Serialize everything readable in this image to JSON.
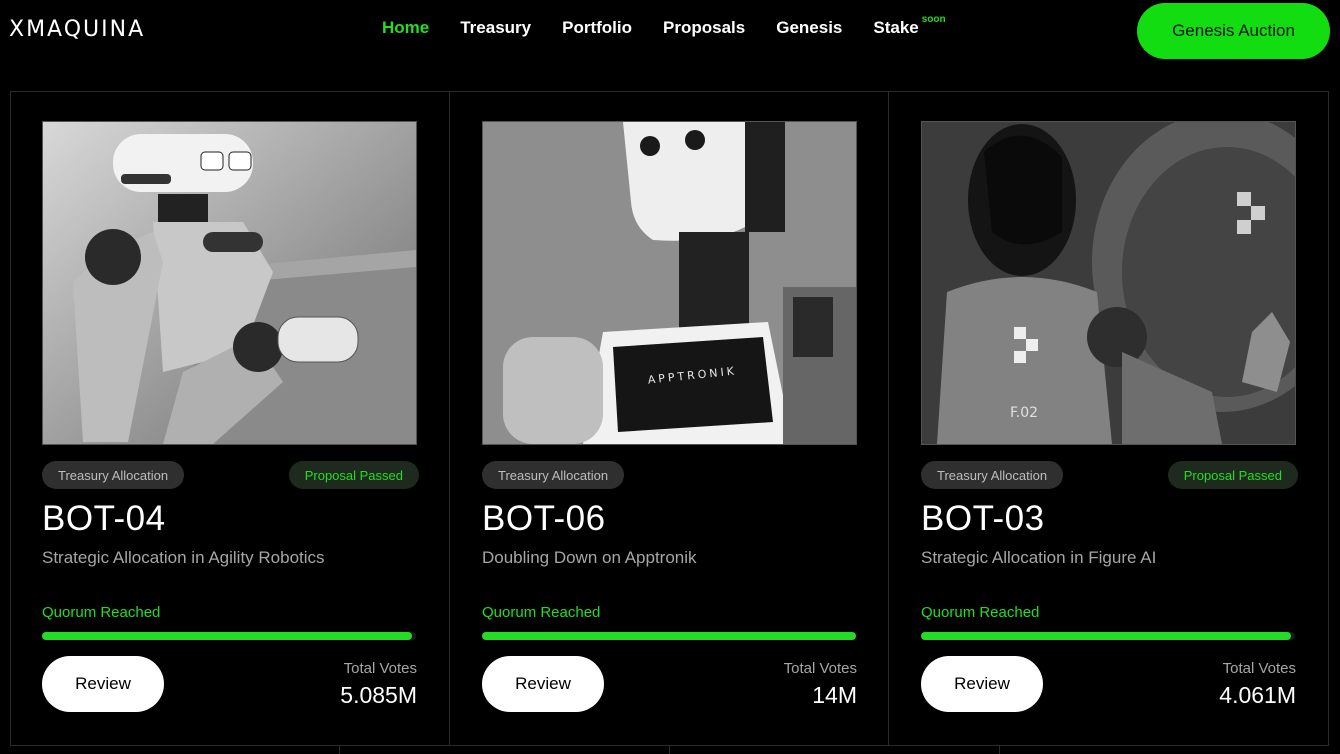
{
  "header": {
    "logo": "XMAQUINA",
    "nav": [
      {
        "label": "Home",
        "active": true
      },
      {
        "label": "Treasury"
      },
      {
        "label": "Portfolio"
      },
      {
        "label": "Proposals"
      },
      {
        "label": "Genesis"
      },
      {
        "label": "Stake",
        "badge": "soon"
      }
    ],
    "cta_label": "Genesis Auction"
  },
  "cards": [
    {
      "tag": "Treasury Allocation",
      "status": "Proposal Passed",
      "title": "BOT-04",
      "subtitle": "Strategic Allocation in Agility Robotics",
      "quorum": "Quorum Reached",
      "progress": 0.99,
      "review_label": "Review",
      "votes_label": "Total Votes",
      "votes_value": "5.085M",
      "image_icon": "robot-photo-icon"
    },
    {
      "tag": "Treasury Allocation",
      "status": "",
      "title": "BOT-06",
      "subtitle": "Doubling Down on Apptronik",
      "quorum": "Quorum Reached",
      "progress": 1.0,
      "review_label": "Review",
      "votes_label": "Total Votes",
      "votes_value": "14M",
      "image_icon": "robot-photo-icon",
      "image_text": "APPTRONIK"
    },
    {
      "tag": "Treasury Allocation",
      "status": "Proposal Passed",
      "title": "BOT-03",
      "subtitle": "Strategic Allocation in Figure AI",
      "quorum": "Quorum Reached",
      "progress": 0.99,
      "review_label": "Review",
      "votes_label": "Total Votes",
      "votes_value": "4.061M",
      "image_icon": "robot-photo-icon",
      "image_text": "F.02"
    }
  ],
  "colors": {
    "accent": "#22dd22",
    "background": "#000000",
    "tag_bg": "#2f2f2f",
    "muted_text": "#a6a6a6"
  }
}
